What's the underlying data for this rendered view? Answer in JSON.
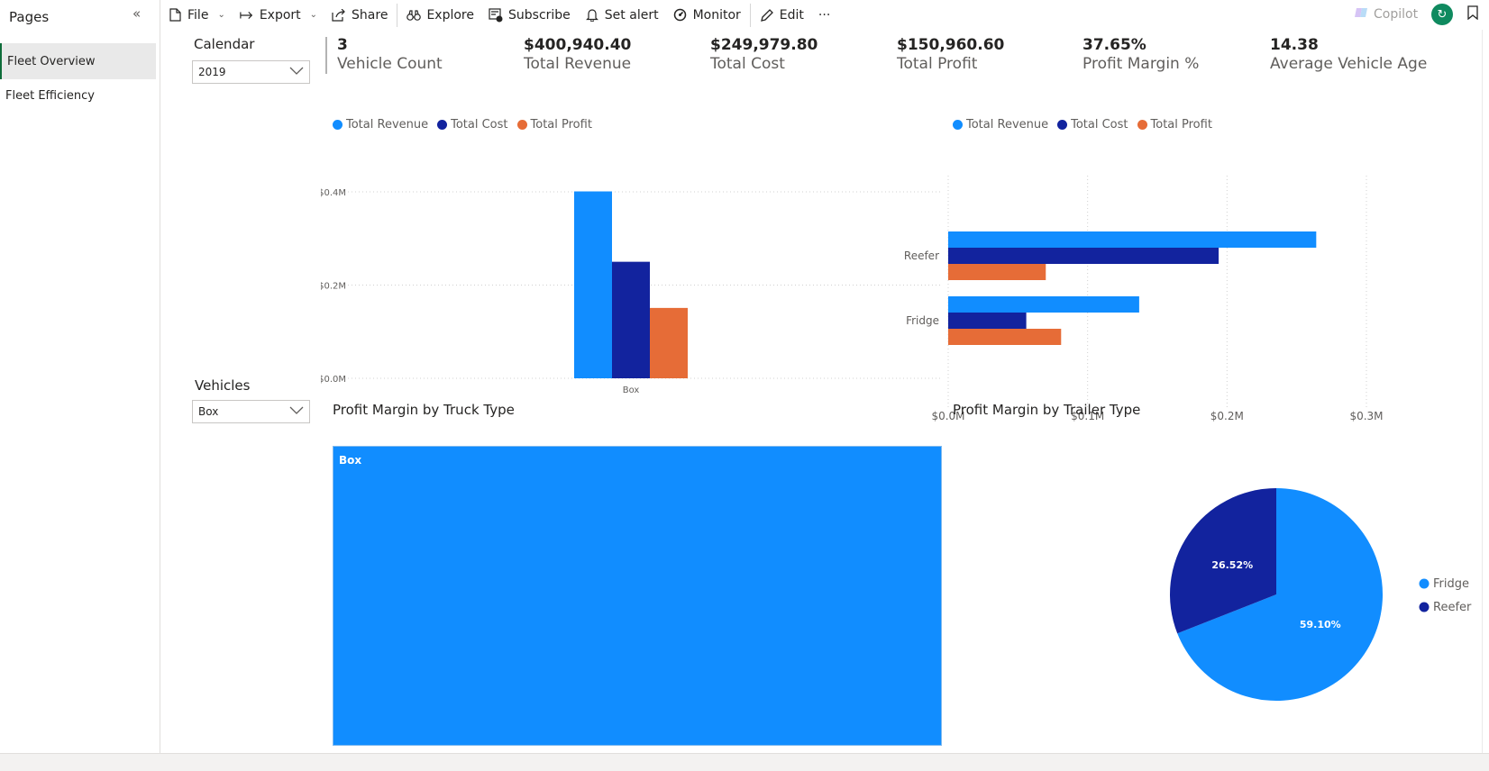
{
  "pages_pane": {
    "title": "Pages",
    "pages": [
      "Fleet Overview",
      "Fleet Efficiency"
    ]
  },
  "toolbar": {
    "file": "File",
    "export": "Export",
    "share": "Share",
    "explore": "Explore",
    "subscribe": "Subscribe",
    "set_alert": "Set alert",
    "monitor": "Monitor",
    "edit": "Edit",
    "more": "···",
    "copilot": "Copilot"
  },
  "slicers": {
    "calendar": {
      "title": "Calendar",
      "value": "2019"
    },
    "vehicles": {
      "title": "Vehicles",
      "value": "Box"
    }
  },
  "kpis": [
    {
      "value": "3",
      "label": "Vehicle Count"
    },
    {
      "value": "$400,940.40",
      "label": "Total Revenue"
    },
    {
      "value": "$249,979.80",
      "label": "Total Cost"
    },
    {
      "value": "$150,960.60",
      "label": "Total Profit"
    },
    {
      "value": "37.65%",
      "label": "Profit Margin %"
    },
    {
      "value": "14.38",
      "label": "Average Vehicle Age"
    }
  ],
  "colors": {
    "revenue": "#118dff",
    "cost": "#12239e",
    "profit": "#e66c37",
    "accent_green": "#0f8a5f"
  },
  "icons": {
    "file": "file-icon",
    "export": "export-arrow-icon",
    "share": "share-icon",
    "explore": "binoculars-icon",
    "subscribe": "subscribe-icon",
    "set_alert": "bell-icon",
    "monitor": "monitor-gauge-icon",
    "edit": "pencil-icon",
    "copilot": "copilot-icon",
    "refresh": "refresh-icon",
    "bookmark": "bookmark-icon"
  },
  "chart_data": [
    {
      "type": "bar",
      "title": "",
      "categories": [
        "Box"
      ],
      "series": [
        {
          "name": "Total Revenue",
          "values": [
            400940.4
          ]
        },
        {
          "name": "Total Cost",
          "values": [
            249979.8
          ]
        },
        {
          "name": "Total Profit",
          "values": [
            150960.6
          ]
        }
      ],
      "y_ticks": [
        "$0.0M",
        "$0.2M",
        "$0.4M"
      ],
      "ylim": [
        0,
        400000
      ],
      "legend": "top-left",
      "grid": true
    },
    {
      "type": "bar",
      "orientation": "horizontal",
      "title": "",
      "categories": [
        "Reefer",
        "Fridge"
      ],
      "series": [
        {
          "name": "Total Revenue",
          "values": [
            264000,
            137000
          ]
        },
        {
          "name": "Total Cost",
          "values": [
            194000,
            56000
          ]
        },
        {
          "name": "Total Profit",
          "values": [
            70000,
            81000
          ]
        }
      ],
      "x_ticks": [
        "$0.0M",
        "$0.1M",
        "$0.2M",
        "$0.3M"
      ],
      "xlim": [
        0,
        300000
      ],
      "legend": "top-left",
      "grid": true
    },
    {
      "type": "treemap",
      "title": "Profit Margin by Truck Type",
      "categories": [
        "Box"
      ],
      "values": [
        1
      ]
    },
    {
      "type": "pie",
      "title": "Profit Margin by Trailer Type",
      "categories": [
        "Fridge",
        "Reefer"
      ],
      "values": [
        59.1,
        26.52
      ],
      "data_labels": [
        "59.10%",
        "26.52%"
      ],
      "legend": "right"
    }
  ]
}
